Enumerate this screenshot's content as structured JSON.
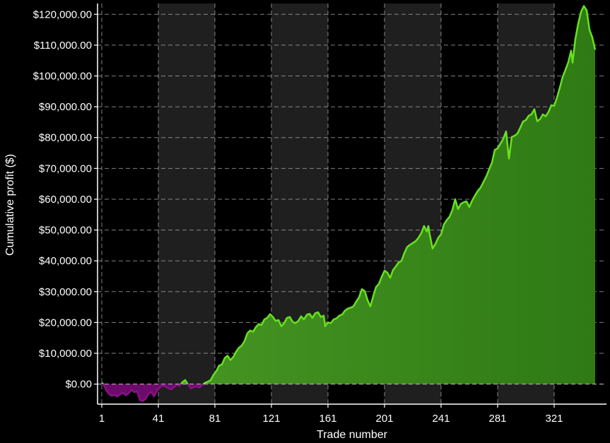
{
  "chart_data": {
    "type": "area",
    "title": "",
    "xlabel": "Trade number",
    "ylabel": "Cumulative profit ($)",
    "xlim": [
      -2,
      358
    ],
    "ylim": [
      -6500,
      123500
    ],
    "x_ticks": [
      1,
      41,
      81,
      121,
      161,
      201,
      241,
      281,
      321
    ],
    "x_tick_labels": [
      "1",
      "41",
      "81",
      "121",
      "161",
      "201",
      "241",
      "281",
      "321"
    ],
    "y_ticks": [
      0,
      10000,
      20000,
      30000,
      40000,
      50000,
      60000,
      70000,
      80000,
      90000,
      100000,
      110000,
      120000
    ],
    "y_tick_labels": [
      "$0.00",
      "$10,000.00",
      "$20,000.00",
      "$30,000.00",
      "$40,000.00",
      "$50,000.00",
      "$60,000.00",
      "$70,000.00",
      "$80,000.00",
      "$90,000.00",
      "$100,000.00",
      "$110,000.00",
      "$120,000.00"
    ],
    "grid": true,
    "shaded_bands": [
      [
        41,
        81
      ],
      [
        121,
        161
      ],
      [
        201,
        241
      ],
      [
        281,
        321
      ]
    ],
    "series": [
      {
        "points": [
          [
            1,
            500
          ],
          [
            2,
            0
          ],
          [
            3,
            -800
          ],
          [
            4,
            -2000
          ],
          [
            5,
            -2500
          ],
          [
            6,
            -3200
          ],
          [
            8,
            -3800
          ],
          [
            10,
            -3500
          ],
          [
            12,
            -4000
          ],
          [
            14,
            -3300
          ],
          [
            16,
            -2800
          ],
          [
            18,
            -3600
          ],
          [
            20,
            -3000
          ],
          [
            22,
            -1800
          ],
          [
            24,
            -2600
          ],
          [
            26,
            -2400
          ],
          [
            28,
            -5200
          ],
          [
            30,
            -5500
          ],
          [
            32,
            -4800
          ],
          [
            34,
            -3200
          ],
          [
            36,
            -2500
          ],
          [
            38,
            -4000
          ],
          [
            40,
            -2200
          ],
          [
            42,
            -1000
          ],
          [
            44,
            -500
          ],
          [
            46,
            -800
          ],
          [
            48,
            -1300
          ],
          [
            50,
            -1700
          ],
          [
            52,
            -1000
          ],
          [
            54,
            -200
          ],
          [
            56,
            -600
          ],
          [
            58,
            600
          ],
          [
            60,
            1300
          ],
          [
            62,
            -100
          ],
          [
            64,
            -1400
          ],
          [
            66,
            -1000
          ],
          [
            68,
            -700
          ],
          [
            70,
            -1100
          ],
          [
            72,
            -300
          ],
          [
            74,
            400
          ],
          [
            76,
            800
          ],
          [
            78,
            1300
          ],
          [
            80,
            3000
          ],
          [
            82,
            4200
          ],
          [
            84,
            6000
          ],
          [
            86,
            6400
          ],
          [
            88,
            8500
          ],
          [
            90,
            9200
          ],
          [
            92,
            7800
          ],
          [
            94,
            8800
          ],
          [
            96,
            10500
          ],
          [
            98,
            11800
          ],
          [
            100,
            12500
          ],
          [
            102,
            14000
          ],
          [
            104,
            16500
          ],
          [
            106,
            17400
          ],
          [
            108,
            17000
          ],
          [
            110,
            18500
          ],
          [
            112,
            19500
          ],
          [
            114,
            19200
          ],
          [
            116,
            21000
          ],
          [
            118,
            21500
          ],
          [
            120,
            22700
          ],
          [
            122,
            21800
          ],
          [
            124,
            20500
          ],
          [
            126,
            20800
          ],
          [
            128,
            18800
          ],
          [
            130,
            19800
          ],
          [
            132,
            21500
          ],
          [
            134,
            21800
          ],
          [
            136,
            20200
          ],
          [
            138,
            19800
          ],
          [
            140,
            20500
          ],
          [
            142,
            22000
          ],
          [
            144,
            21000
          ],
          [
            146,
            22500
          ],
          [
            148,
            22800
          ],
          [
            150,
            21500
          ],
          [
            152,
            23000
          ],
          [
            154,
            23300
          ],
          [
            156,
            21800
          ],
          [
            158,
            22200
          ],
          [
            159,
            18800
          ],
          [
            161,
            20000
          ],
          [
            163,
            19800
          ],
          [
            165,
            21000
          ],
          [
            167,
            21300
          ],
          [
            169,
            22200
          ],
          [
            171,
            22600
          ],
          [
            173,
            23800
          ],
          [
            175,
            24500
          ],
          [
            177,
            24800
          ],
          [
            179,
            25200
          ],
          [
            181,
            26800
          ],
          [
            183,
            28200
          ],
          [
            185,
            30800
          ],
          [
            187,
            30200
          ],
          [
            189,
            27300
          ],
          [
            191,
            25200
          ],
          [
            193,
            28500
          ],
          [
            195,
            31500
          ],
          [
            197,
            32500
          ],
          [
            199,
            34800
          ],
          [
            201,
            36800
          ],
          [
            203,
            36200
          ],
          [
            205,
            34500
          ],
          [
            207,
            37000
          ],
          [
            209,
            38200
          ],
          [
            211,
            39500
          ],
          [
            213,
            40000
          ],
          [
            215,
            42500
          ],
          [
            217,
            44500
          ],
          [
            219,
            45200
          ],
          [
            221,
            45800
          ],
          [
            223,
            46400
          ],
          [
            225,
            47500
          ],
          [
            227,
            49000
          ],
          [
            229,
            51300
          ],
          [
            231,
            49500
          ],
          [
            232,
            51300
          ],
          [
            233,
            48500
          ],
          [
            235,
            44000
          ],
          [
            237,
            45500
          ],
          [
            239,
            47500
          ],
          [
            241,
            48600
          ],
          [
            243,
            51800
          ],
          [
            245,
            53200
          ],
          [
            247,
            54300
          ],
          [
            249,
            56500
          ],
          [
            251,
            60000
          ],
          [
            253,
            56800
          ],
          [
            255,
            58500
          ],
          [
            257,
            59000
          ],
          [
            259,
            59300
          ],
          [
            261,
            57500
          ],
          [
            263,
            59600
          ],
          [
            265,
            61200
          ],
          [
            267,
            62700
          ],
          [
            269,
            63800
          ],
          [
            271,
            65600
          ],
          [
            273,
            67400
          ],
          [
            275,
            69700
          ],
          [
            277,
            71900
          ],
          [
            279,
            76000
          ],
          [
            281,
            76500
          ],
          [
            283,
            78000
          ],
          [
            285,
            79600
          ],
          [
            287,
            82000
          ],
          [
            289,
            73200
          ],
          [
            291,
            80200
          ],
          [
            293,
            80600
          ],
          [
            295,
            81300
          ],
          [
            297,
            83200
          ],
          [
            299,
            85200
          ],
          [
            301,
            85700
          ],
          [
            303,
            87100
          ],
          [
            305,
            87600
          ],
          [
            307,
            89200
          ],
          [
            309,
            85300
          ],
          [
            311,
            86000
          ],
          [
            313,
            87500
          ],
          [
            315,
            86900
          ],
          [
            317,
            88300
          ],
          [
            319,
            90500
          ],
          [
            321,
            90300
          ],
          [
            323,
            93000
          ],
          [
            325,
            96200
          ],
          [
            327,
            99700
          ],
          [
            329,
            102000
          ],
          [
            331,
            104500
          ],
          [
            333,
            108200
          ],
          [
            334,
            104300
          ],
          [
            336,
            112000
          ],
          [
            338,
            117000
          ],
          [
            340,
            120800
          ],
          [
            342,
            122700
          ],
          [
            344,
            121300
          ],
          [
            346,
            115000
          ],
          [
            348,
            112500
          ],
          [
            350,
            108500
          ]
        ]
      }
    ],
    "colors": {
      "background": "#000000",
      "band": "#1f1f1f",
      "grid": "#aaaaaa",
      "axis": "#ffffff",
      "positive_line": "#66e21e",
      "positive_fill": "#3c8a1c",
      "negative_line": "#8a1088",
      "negative_fill": "#6c0c6a"
    }
  }
}
